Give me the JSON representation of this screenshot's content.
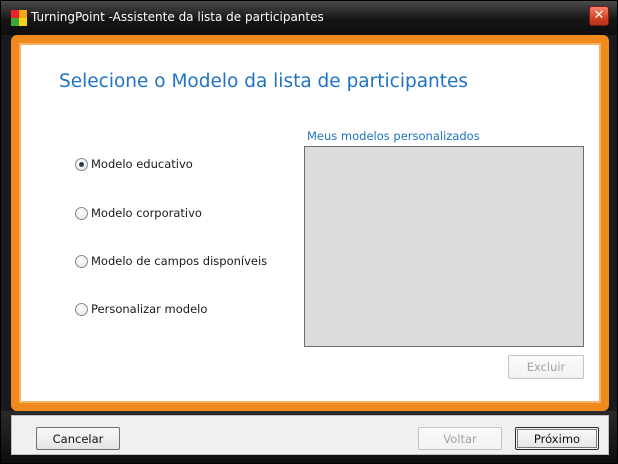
{
  "window": {
    "title": "TurningPoint -Assistente da lista de participantes",
    "close_glyph": "✕",
    "accent_color": "#f08a1c"
  },
  "heading": "Selecione o Modelo da lista de participantes",
  "template_options": [
    {
      "label": "Modelo educativo",
      "selected": true
    },
    {
      "label": "Modelo corporativo",
      "selected": false
    },
    {
      "label": "Modelo de campos disponíveis",
      "selected": false
    },
    {
      "label": "Personalizar modelo",
      "selected": false
    }
  ],
  "custom_models": {
    "label": "Meus modelos personalizados",
    "items": [],
    "delete_label": "Excluir"
  },
  "footer": {
    "cancel_label": "Cancelar",
    "back_label": "Voltar",
    "next_label": "Próximo"
  },
  "icons": {
    "app": "turningpoint-app-icon",
    "close": "close-icon",
    "radio": "radio-button-icon"
  }
}
